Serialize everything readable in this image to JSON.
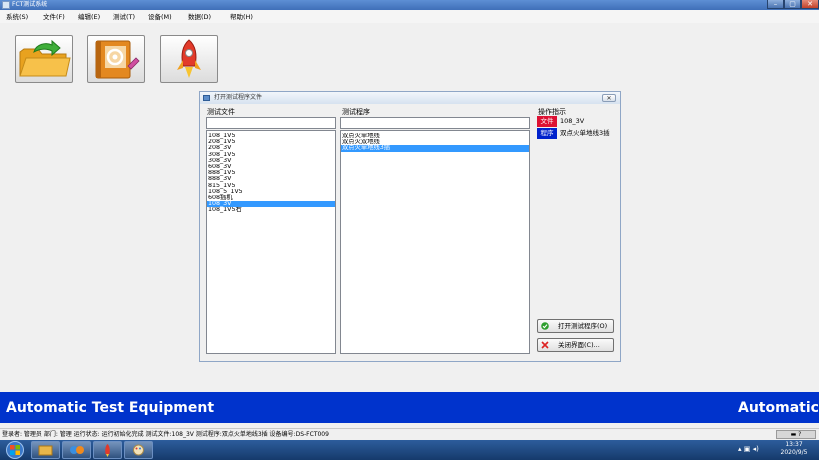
{
  "window": {
    "title": "FCT测试系统",
    "minimize": "–",
    "maximize": "▢",
    "close": "✕"
  },
  "menu": [
    "系统(S)",
    "文件(F)",
    "编辑(E)",
    "测试(T)",
    "设备(M)",
    "数据(D)",
    "帮助(H)"
  ],
  "toolbar": {
    "icons": [
      "open-folder-icon",
      "address-book-icon",
      "rocket-icon"
    ]
  },
  "dialog": {
    "title": "打开测试程序文件",
    "close_label": "✕",
    "file_list_label": "测试文件",
    "file_filter_value": "",
    "files": [
      "108_1V5",
      "208_1V5",
      "208_3V",
      "308_1V5",
      "308_3V",
      "608_3V",
      "888_1V5",
      "888_3V",
      "815_1V5",
      "108_5_1V5",
      "608插机",
      "108_3V",
      "108_1V5右"
    ],
    "selected_file": "108_3V",
    "program_list_label": "测试程序",
    "program_filter_value": "",
    "programs": [
      "双点火单地线",
      "双点火双地线",
      "双点火单地线3插"
    ],
    "selected_program": "双点火单地线3插",
    "indicator": {
      "label": "操作指示",
      "file_badge": "文件",
      "file_value": "108_3V",
      "program_badge": "程序",
      "program_value": "双点火单地线3插"
    },
    "open_button": "打开测试程序(O)",
    "close_button": "关闭界面(C)..."
  },
  "banner": {
    "text": "Automatic Test Equipment",
    "text_repeat": "Automatic"
  },
  "statusbar": {
    "text": "登录者: 管理员 部门: 管理 运行状态: 运行初始化完成 测试文件:108_3V  测试程序:双点火单地线3插  设备编号:DS-FCT009",
    "tools": "▬ ?"
  },
  "taskbar": {
    "time": "13:37",
    "date": "2020/9/5"
  },
  "colors": {
    "banner": "#0033cc",
    "file_badge": "#dd1133",
    "program_badge": "#0022cc",
    "selection": "#3399ff"
  }
}
